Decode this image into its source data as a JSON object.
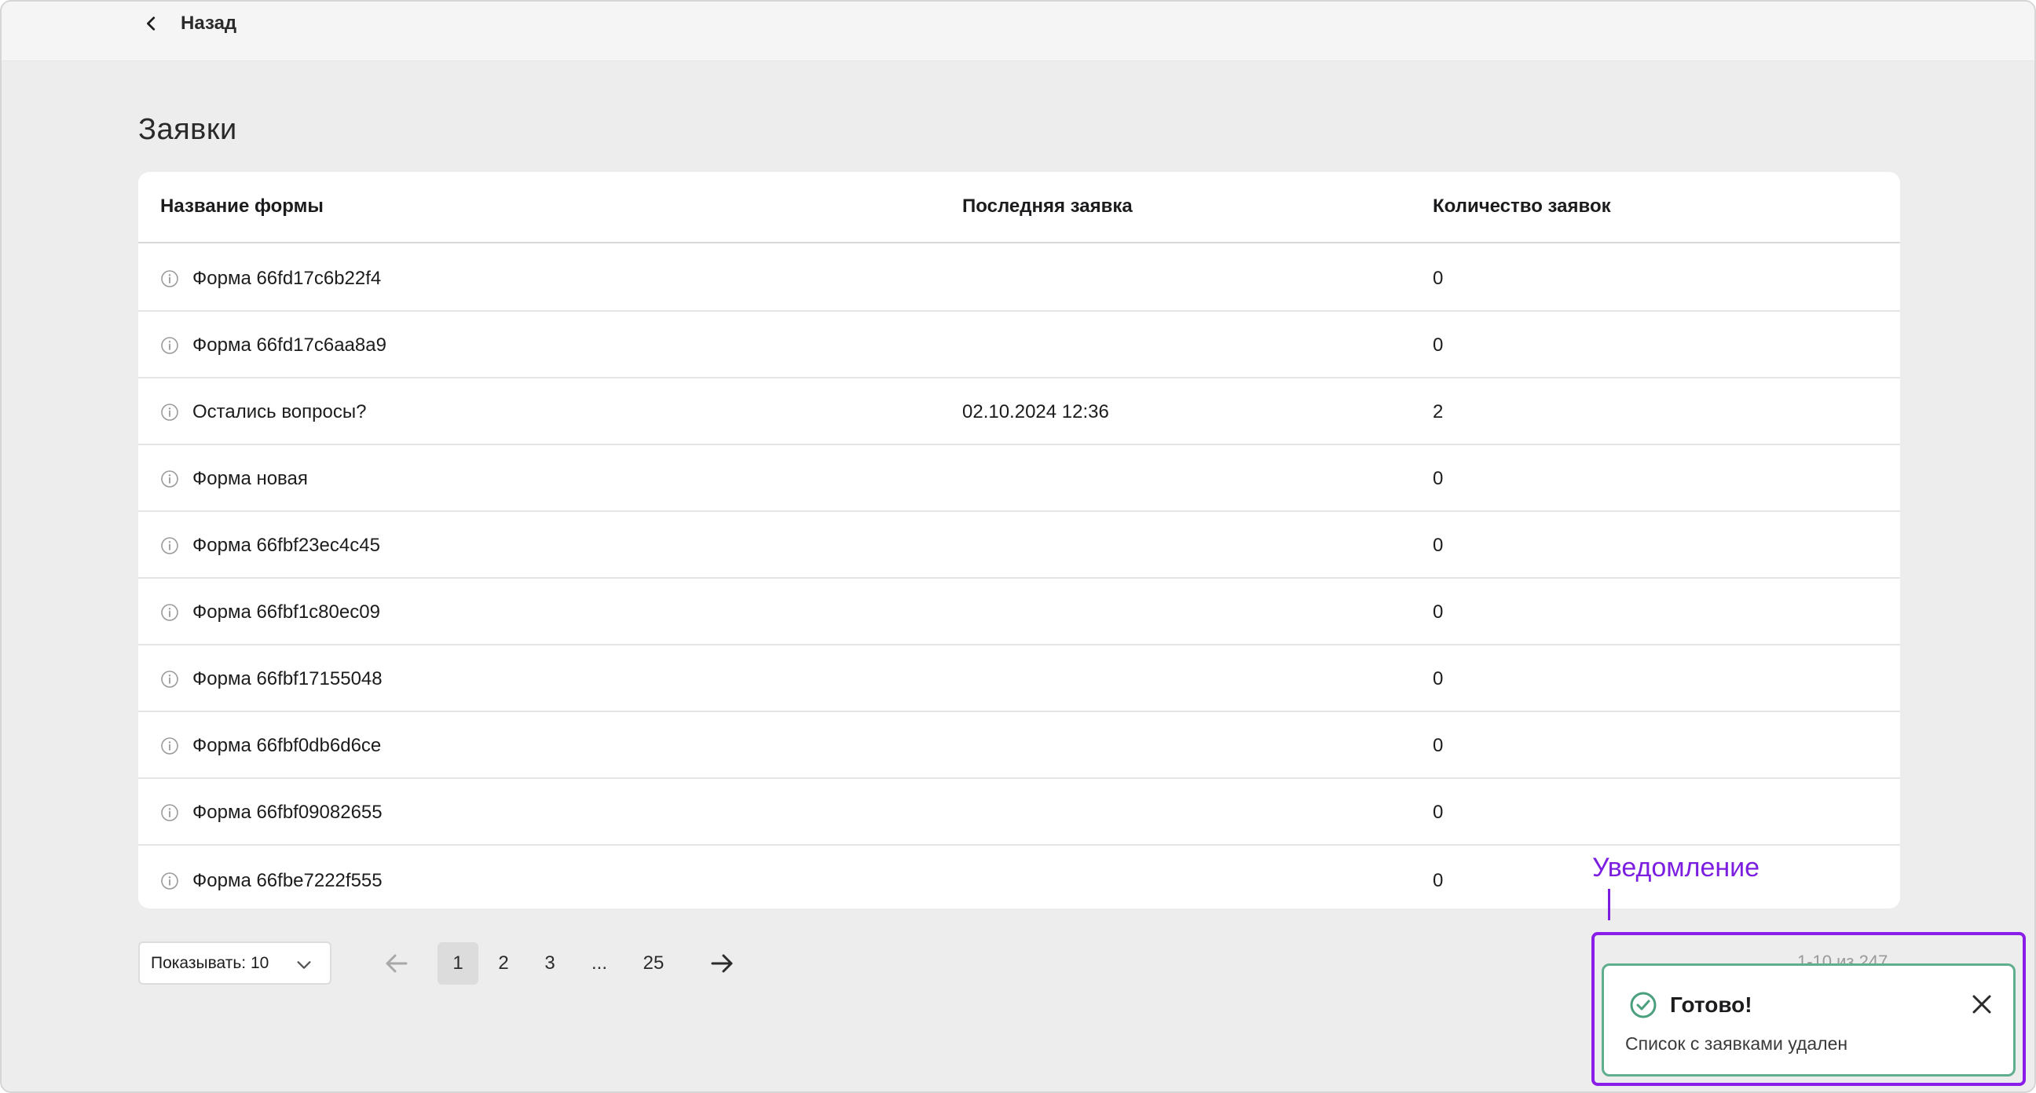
{
  "header": {
    "back_label": "Назад"
  },
  "page": {
    "title": "Заявки"
  },
  "table": {
    "columns": [
      "Название формы",
      "Последняя заявка",
      "Количество заявок"
    ],
    "rows": [
      {
        "name": "Форма 66fd17c6b22f4",
        "last": "",
        "count": "0"
      },
      {
        "name": "Форма 66fd17c6aa8a9",
        "last": "",
        "count": "0"
      },
      {
        "name": "Остались вопросы?",
        "last": "02.10.2024 12:36",
        "count": "2"
      },
      {
        "name": "Форма новая",
        "last": "",
        "count": "0"
      },
      {
        "name": "Форма 66fbf23ec4c45",
        "last": "",
        "count": "0"
      },
      {
        "name": "Форма 66fbf1c80ec09",
        "last": "",
        "count": "0"
      },
      {
        "name": "Форма 66fbf17155048",
        "last": "",
        "count": "0"
      },
      {
        "name": "Форма 66fbf0db6d6ce",
        "last": "",
        "count": "0"
      },
      {
        "name": "Форма 66fbf09082655",
        "last": "",
        "count": "0"
      },
      {
        "name": "Форма 66fbe7222f555",
        "last": "",
        "count": "0"
      }
    ]
  },
  "pagination": {
    "page_size_label": "Показывать: 10",
    "pages": [
      "1",
      "2",
      "3",
      "...",
      "25"
    ],
    "current": "1",
    "range_text": "1-10 из 247"
  },
  "toast": {
    "title": "Готово!",
    "message": "Список с заявками удален"
  },
  "annotation": {
    "label": "Уведомление"
  },
  "colors": {
    "accent_purple": "#8a1ee8",
    "toast_border": "#5fae8e",
    "background": "#ededed"
  }
}
